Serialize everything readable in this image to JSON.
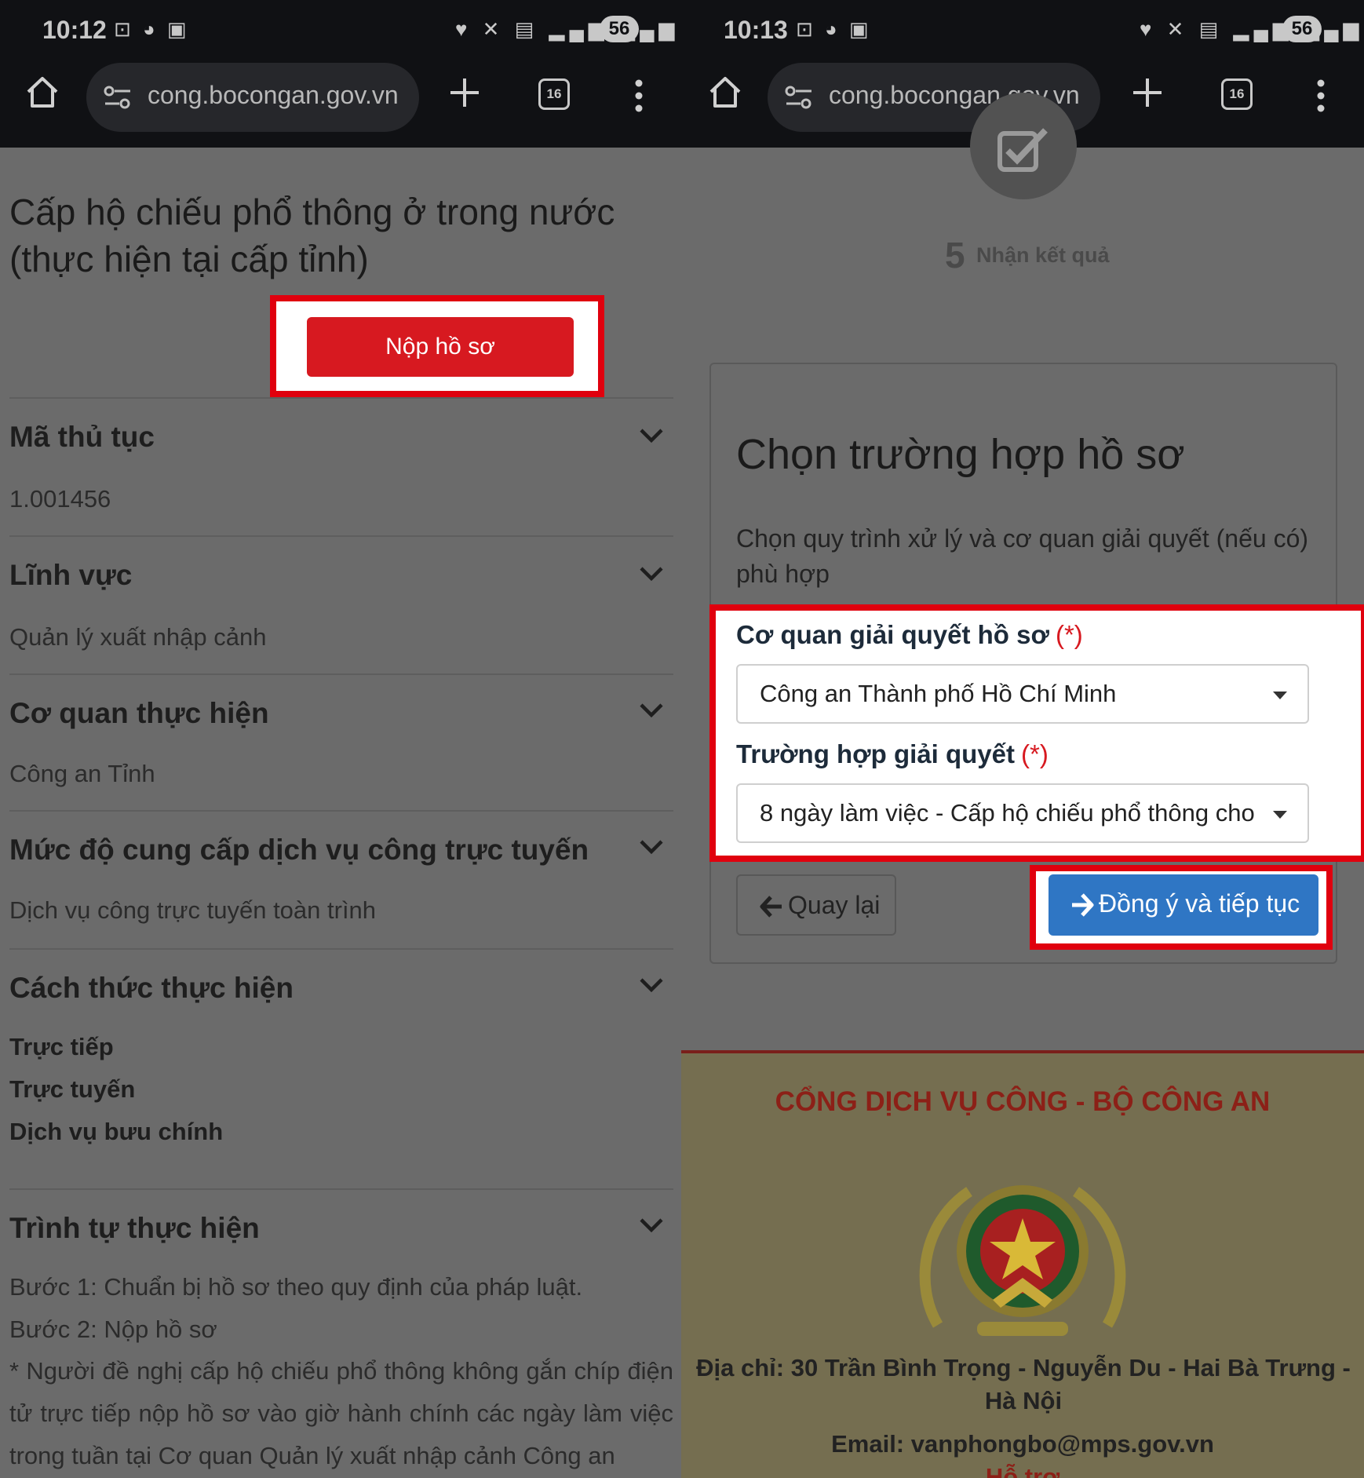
{
  "left": {
    "status": {
      "time": "10:12",
      "battery": "56"
    },
    "browser": {
      "url": "cong.bocongan.gov.vn",
      "tab_count": "16"
    },
    "page_title": "Cấp hộ chiếu phổ thông ở trong nước (thực hiện tại cấp tỉnh)",
    "submit_label": "Nộp hồ sơ",
    "sections": [
      {
        "heading": "Mã thủ tục",
        "value": "1.001456"
      },
      {
        "heading": "Lĩnh vực",
        "value": "Quản lý xuất nhập cảnh"
      },
      {
        "heading": "Cơ quan thực hiện",
        "value": "Công an Tỉnh"
      },
      {
        "heading": "Mức độ cung cấp dịch vụ công trực tuyến",
        "value": "Dịch vụ công trực tuyến toàn trình"
      },
      {
        "heading": "Cách thức thực hiện",
        "items": [
          "Trực tiếp",
          "Trực tuyến",
          "Dịch vụ bưu chính"
        ]
      },
      {
        "heading": "Trình tự thực hiện",
        "lines": [
          "Bước 1: Chuẩn bị hồ sơ theo quy định của pháp luật.",
          "Bước 2: Nộp hồ sơ"
        ],
        "note": "* Người đề nghị cấp hộ chiếu phổ thông không gắn chíp điện tử trực tiếp nộp hồ sơ vào giờ hành chính các ngày làm việc trong tuần tại Cơ quan Quản lý xuất nhập cảnh Công an"
      }
    ]
  },
  "right": {
    "status": {
      "time": "10:13",
      "battery": "56"
    },
    "browser": {
      "url": "cong.bocongan.gov.vn",
      "tab_count": "16"
    },
    "step": {
      "number": "5",
      "label": "Nhận kết quả"
    },
    "card": {
      "title": "Chọn trường hợp hồ sơ",
      "description": "Chọn quy trình xử lý và cơ quan giải quyết (nếu có) phù hợp",
      "agency_label": "Cơ quan giải quyết hồ sơ",
      "agency_value": "Công an Thành phố Hồ Chí Minh",
      "case_label": "Trường hợp giải quyết",
      "case_value": "8 ngày làm việc - Cấp hộ chiếu phổ thông cho",
      "required_mark": "(*)",
      "back_label": "Quay lại",
      "next_label": "Đồng ý và tiếp tục"
    },
    "footer": {
      "title": "CỔNG DỊCH VỤ CÔNG - BỘ CÔNG AN",
      "address": "Địa chỉ: 30 Trần Bình Trọng - Nguyễn Du - Hai Bà Trưng - Hà Nội",
      "email": "Email: vanphongbo@mps.gov.vn",
      "help": "Hỗ trợ"
    }
  },
  "colors": {
    "highlight": "#e0000e",
    "submit": "#d71920",
    "primary": "#2f76c4",
    "footer_title": "#8c2017"
  }
}
